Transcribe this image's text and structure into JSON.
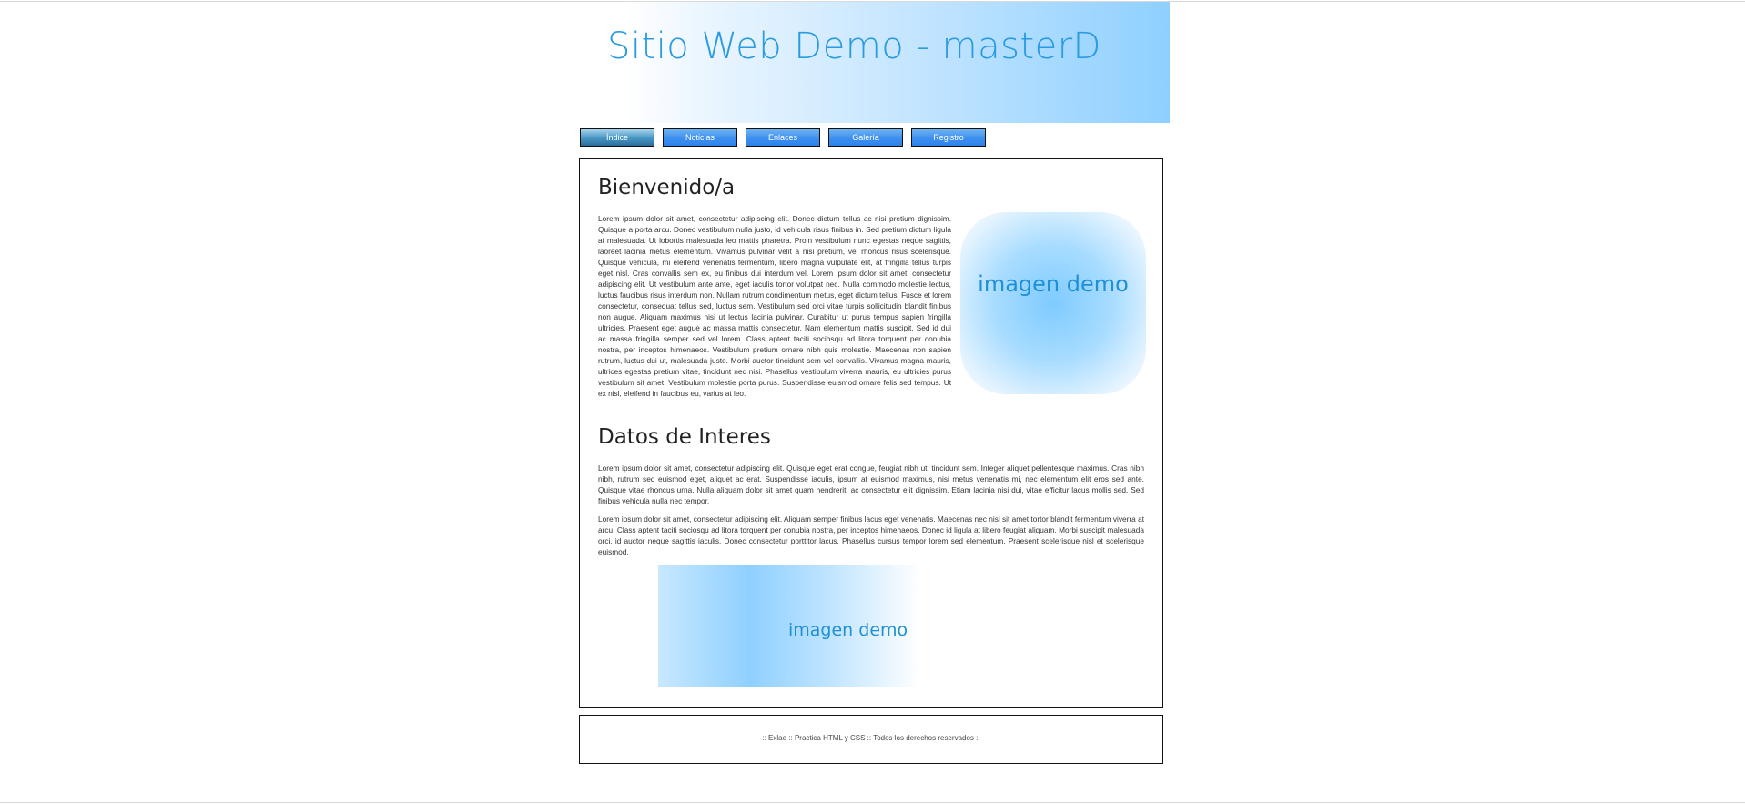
{
  "header": {
    "title": "Sitio Web Demo - masterD"
  },
  "nav": {
    "items": [
      {
        "label": "Índice"
      },
      {
        "label": "Noticias"
      },
      {
        "label": "Enlaces"
      },
      {
        "label": "Galería"
      },
      {
        "label": "Registro"
      }
    ],
    "active_index": 0
  },
  "main": {
    "welcome_title": "Bienvenido/a",
    "welcome_text": "Lorem ipsum dolor sit amet, consectetur adipiscing elit. Donec dictum tellus ac nisi pretium dignissim. Quisque a porta arcu. Donec vestibulum nulla justo, id vehicula risus finibus in. Sed pretium dictum ligula at malesuada. Ut lobortis malesuada leo mattis pharetra. Proin vestibulum nunc egestas neque sagittis, laoreet lacinia metus elementum. Vivamus pulvinar velit a nisi pretium, vel rhoncus risus scelerisque. Quisque vehicula, mi eleifend venenatis fermentum, libero magna vulputate elit, at fringilla tellus turpis eget nisl. Cras convallis sem ex, eu finibus dui interdum vel. Lorem ipsum dolor sit amet, consectetur adipiscing elit. Ut vestibulum ante ante, eget iaculis tortor volutpat nec. Nulla commodo molestie lectus, luctus faucibus risus interdum non. Nullam rutrum condimentum metus, eget dictum tellus. Fusce et lorem consectetur, consequat tellus sed, luctus sem. Vestibulum sed orci vitae turpis sollicitudin blandit finibus non augue. Aliquam maximus nisi ut lectus lacinia pulvinar. Curabitur ut purus tempus sapien fringilla ultricies. Praesent eget augue ac massa mattis consectetur. Nam elementum mattis suscipit. Sed id dui ac massa fringilla semper sed vel lorem. Class aptent taciti sociosqu ad litora torquent per conubia nostra, per inceptos himenaeos. Vestibulum pretium ornare nibh quis molestie. Maecenas non sapien rutrum, luctus dui ut, malesuada justo. Morbi auctor tincidunt sem vel convallis. Vivamus magna mauris, ultrices egestas pretium vitae, tincidunt nec nisi. Phasellus vestibulum viverra mauris, eu ultricies purus vestibulum sit amet. Vestibulum molestie porta purus. Suspendisse euismod ornare felis sed tempus. Ut ex nisl, eleifend in faucibus eu, varius at leo.",
    "side_image_label": "imagen demo",
    "data_title": "Datos de Interes",
    "data_text_1": "Lorem ipsum dolor sit amet, consectetur adipiscing elit. Quisque eget erat congue, feugiat nibh ut, tincidunt sem. Integer aliquet pellentesque maximus. Cras nibh nibh, rutrum sed euismod eget, aliquet ac erat. Suspendisse iaculis, ipsum at euismod maximus, nisi metus venenatis mi, nec elementum elit eros sed ante. Quisque vitae rhoncus urna. Nulla aliquam dolor sit amet quam hendrerit, ac consectetur elit dignissim. Etiam lacinia nisi dui, vitae efficitur lacus mollis sed. Sed finibus vehicula nulla nec tempor.",
    "data_text_2": "Lorem ipsum dolor sit amet, consectetur adipiscing elit. Aliquam semper finibus lacus eget venenatis. Maecenas nec nisl sit amet tortor blandit fermentum viverra at arcu. Class aptent taciti sociosqu ad litora torquent per conubia nostra, per inceptos himenaeos. Donec id ligula at libero feugiat aliquam. Morbi suscipit malesuada orci, id auctor neque sagittis iaculis. Donec consectetur porttitor lacus. Phasellus cursus tempor lorem sed elementum. Praesent scelerisque nisl et scelerisque euismod.",
    "wide_image_label": "imagen demo"
  },
  "footer": {
    "text": ":: Exlae :: Practica HTML y CSS :: Todos los derechos reservados ::"
  },
  "colors": {
    "accent": "#2a9be0",
    "nav_button": "#3d8ff0",
    "nav_active": "#4c9bc9"
  }
}
